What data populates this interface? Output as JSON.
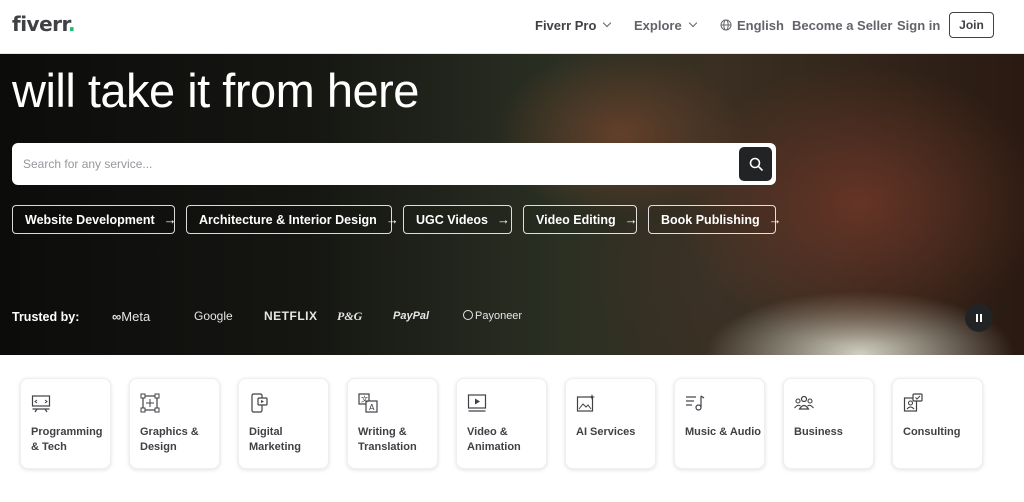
{
  "header": {
    "logo_text": "fiverr",
    "logo_dot": ".",
    "fiverr_pro": "Fiverr Pro",
    "explore": "Explore",
    "language": "English",
    "become_seller": "Become a Seller",
    "sign_in": "Sign in",
    "join": "Join"
  },
  "hero": {
    "title": "will take it from here",
    "search_placeholder": "Search for any service...",
    "chips": [
      {
        "label": "Website Development"
      },
      {
        "label": "Architecture & Interior Design"
      },
      {
        "label": "UGC Videos"
      },
      {
        "label": "Video Editing"
      },
      {
        "label": "Book Publishing"
      }
    ],
    "trusted_label": "Trusted by:",
    "brands": [
      "Meta",
      "Google",
      "NETFLIX",
      "P&G",
      "PayPal",
      "Payoneer"
    ]
  },
  "categories": [
    {
      "label": "Programming & Tech",
      "icon": "programming-icon"
    },
    {
      "label": "Graphics & Design",
      "icon": "graphics-icon"
    },
    {
      "label": "Digital Marketing",
      "icon": "digital-marketing-icon"
    },
    {
      "label": "Writing & Translation",
      "icon": "translation-icon"
    },
    {
      "label": "Video & Animation",
      "icon": "video-icon"
    },
    {
      "label": "AI Services",
      "icon": "ai-icon"
    },
    {
      "label": "Music & Audio",
      "icon": "music-icon"
    },
    {
      "label": "Business",
      "icon": "business-icon"
    },
    {
      "label": "Consulting",
      "icon": "consulting-icon"
    }
  ],
  "colors": {
    "brand_green": "#1dbf73",
    "text_dark": "#404145",
    "button_dark": "#222325"
  }
}
